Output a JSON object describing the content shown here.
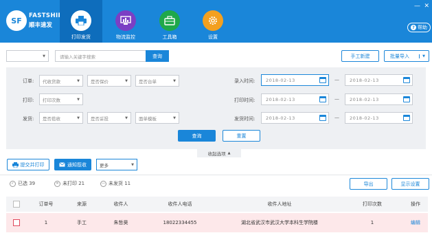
{
  "brand": {
    "logo": "SF",
    "name_en": "FASTSHIP",
    "name_cn": "顺丰速发"
  },
  "nav": [
    {
      "label": "打印发货",
      "icon": "printer-icon",
      "color": "#1a86d9",
      "active": true
    },
    {
      "label": "物流监控",
      "icon": "monitor-icon",
      "color": "#7b3fc4",
      "active": false
    },
    {
      "label": "工具箱",
      "icon": "toolbox-icon",
      "color": "#1fa84a",
      "active": false
    },
    {
      "label": "设置",
      "icon": "gear-icon",
      "color": "#f3a01f",
      "active": false
    }
  ],
  "window_controls": {
    "minimize": "—",
    "close": "✕"
  },
  "help": {
    "label": "帮助",
    "icon_glyph": "?"
  },
  "search": {
    "type_value": "",
    "placeholder": "请输入关键字搜索",
    "button": "查询"
  },
  "actions": {
    "manual_new": "手工新建",
    "batch_import": "批量导入"
  },
  "filters": {
    "order_label": "订单:",
    "print_label": "打印:",
    "ship_label": "发货:",
    "order_selects": [
      "代收货款",
      "是否保价",
      "是否台单"
    ],
    "print_selects": [
      "打印次数"
    ],
    "ship_selects": [
      "是否揽收",
      "是否妥投",
      "面单模板"
    ],
    "entry_time_label": "录入时间:",
    "print_time_label": "打印时间:",
    "ship_time_label": "发货时间:",
    "date_value": "2018-02-13",
    "query": "查询",
    "reset": "重置",
    "collapse": "收起选项",
    "collapse_arrow": "▲"
  },
  "toolbar": {
    "submit_print": "提交并打印",
    "notify_pickup": "通知揽收",
    "more": "更多"
  },
  "stats": [
    {
      "label": "已选 39",
      "glyph": "✓"
    },
    {
      "label": "未打印 21",
      "glyph": "✕"
    },
    {
      "label": "未发货 11",
      "glyph": "—"
    }
  ],
  "export": "导出",
  "display_settings": "显示设置",
  "table": {
    "headers": [
      "订单号",
      "来源",
      "收件人",
      "收件人电话",
      "收件人地址",
      "打印次数",
      "操作"
    ],
    "rows": [
      {
        "order_no": "1",
        "source": "手工",
        "recipient": "朱哲昊",
        "phone": "18022334455",
        "address": "湖北省武汉市武汉大学本科生学院楼",
        "print_count": "1",
        "action": "编辑"
      }
    ]
  }
}
